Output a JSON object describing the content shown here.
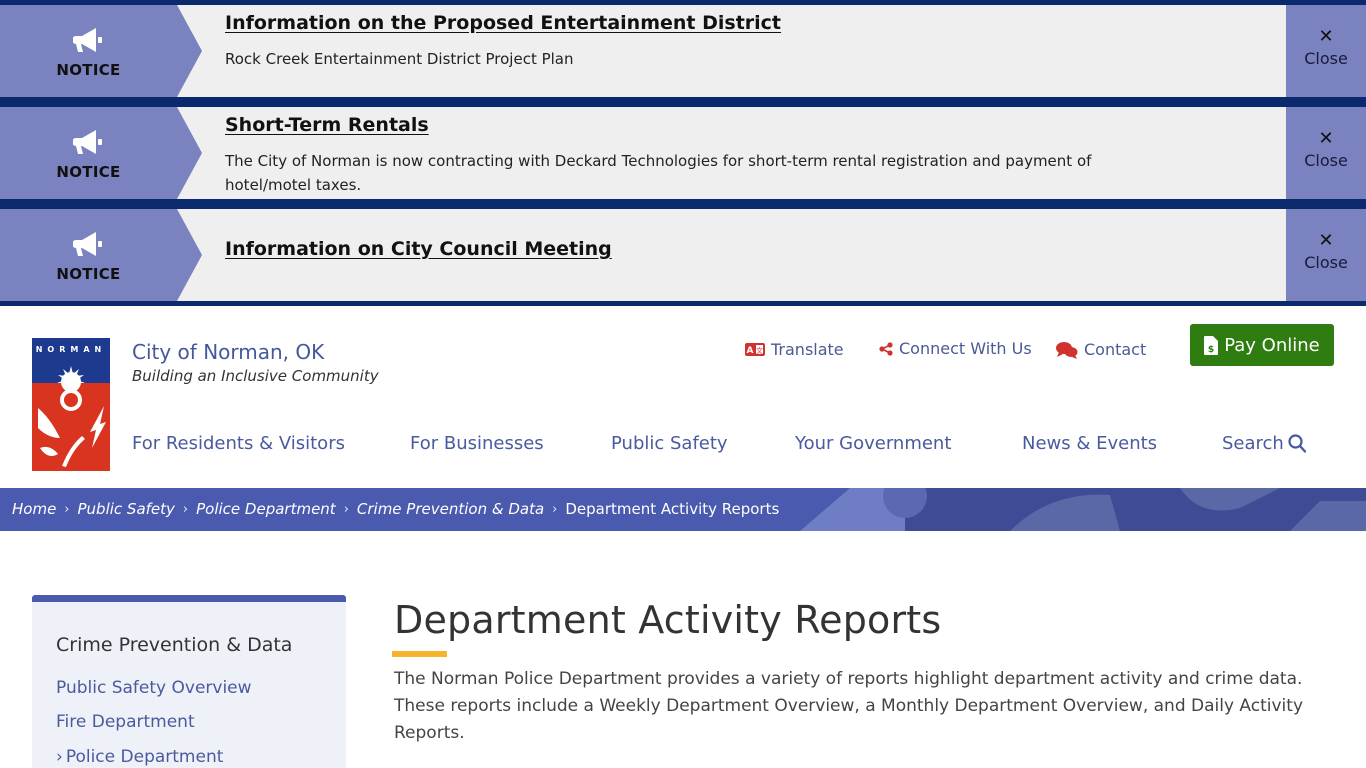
{
  "alerts": [
    {
      "tag": "NOTICE",
      "title": "Information on the Proposed Entertainment District",
      "body": "Rock Creek Entertainment District Project Plan",
      "close_label": "Close",
      "close_glyph": "✕"
    },
    {
      "tag": "NOTICE",
      "title": "Short-Term Rentals",
      "body": "The City of Norman is now contracting with Deckard Technologies for short-term rental registration and payment of hotel/motel taxes.",
      "close_label": "Close",
      "close_glyph": "✕"
    },
    {
      "tag": "NOTICE",
      "title": "Information on City Council Meeting",
      "body": "",
      "close_label": "Close",
      "close_glyph": "✕"
    }
  ],
  "header": {
    "site_name": "City of Norman, OK",
    "tagline": "Building an Inclusive Community",
    "logo_text": "NORMAN",
    "utility": {
      "translate": "Translate",
      "connect": "Connect With Us",
      "contact": "Contact"
    },
    "pay_online": "Pay Online"
  },
  "nav": {
    "items": [
      "For Residents & Visitors",
      "For Businesses",
      "Public Safety",
      "Your Government",
      "News & Events"
    ],
    "search": "Search"
  },
  "breadcrumb": {
    "items": [
      "Home",
      "Public Safety",
      "Police Department",
      "Crime Prevention & Data"
    ],
    "current": "Department Activity Reports",
    "separator": "›"
  },
  "sidebar": {
    "title": "Crime Prevention & Data",
    "items": [
      "Public Safety Overview",
      "Fire Department",
      "Police Department"
    ],
    "expanded_marker": "›"
  },
  "main": {
    "title": "Department Activity Reports",
    "intro": "The Norman Police Department provides a variety of reports highlight department activity and crime data. These reports include a Weekly Department Overview, a Monthly Department Overview, and Daily Activity Reports."
  },
  "colors": {
    "alert_band": "#0b2a6e",
    "alert_tag": "#7a82bf",
    "brand_blue": "#4a5aae",
    "link_blue": "#4a5a9e",
    "pay_green": "#2f7d10",
    "accent_gold": "#f6b42c",
    "icon_red": "#d2322d"
  }
}
